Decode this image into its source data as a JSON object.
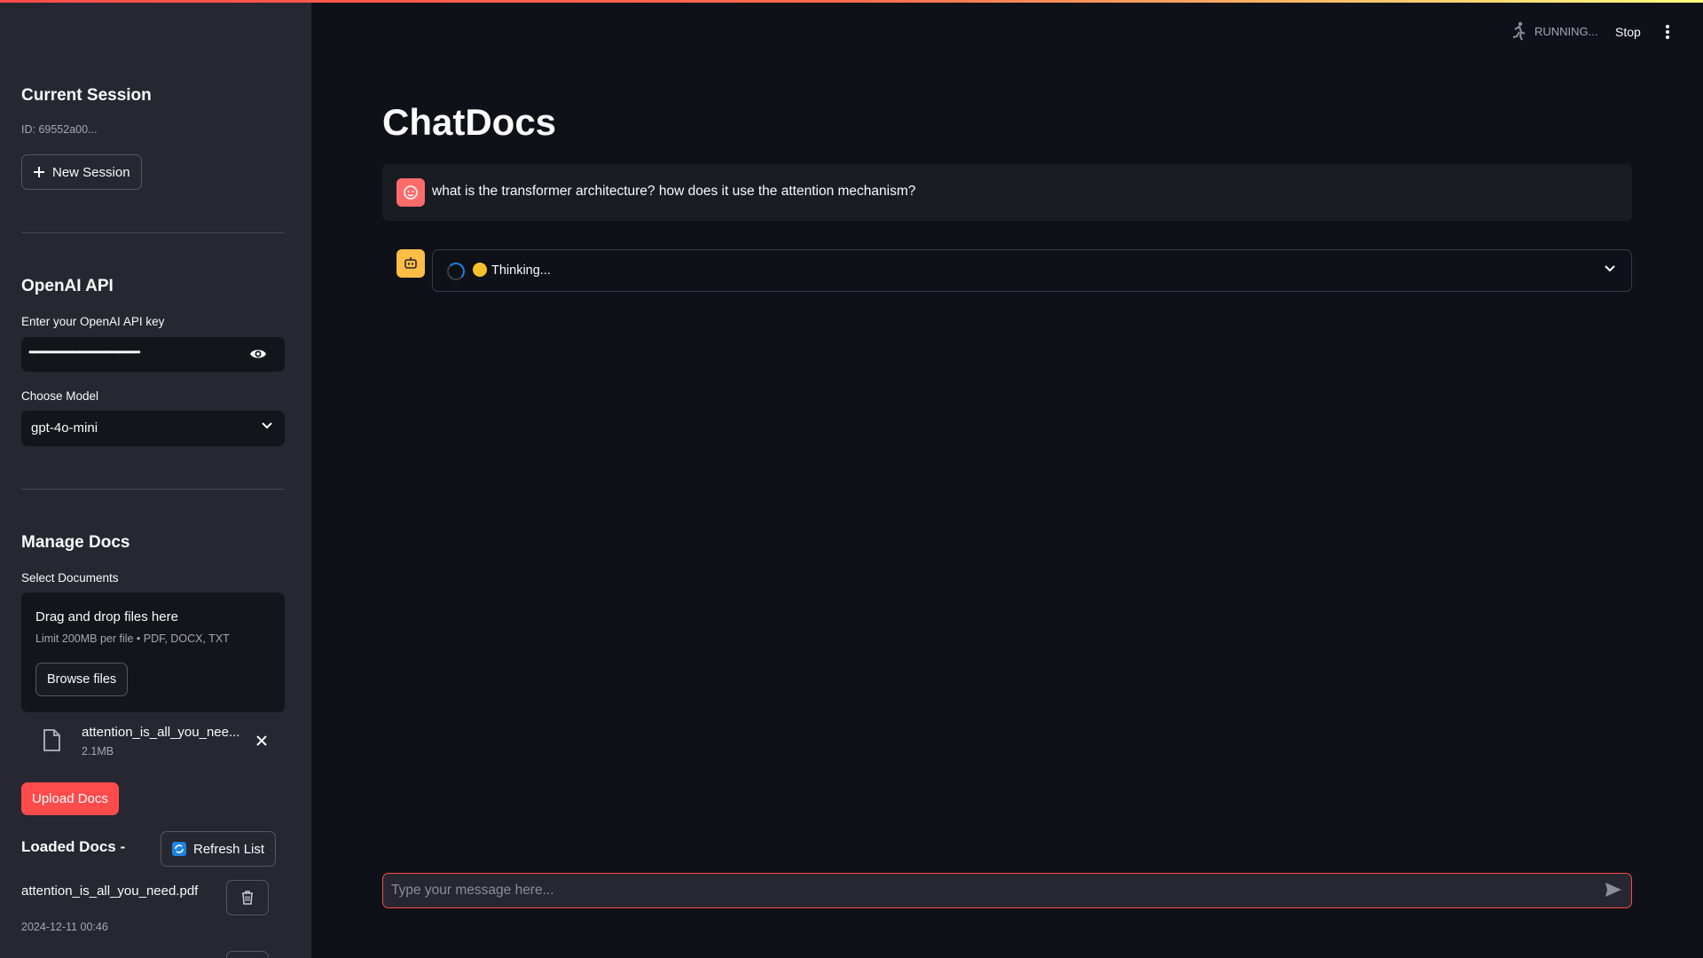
{
  "sidebar": {
    "session": {
      "heading": "Current Session",
      "id_text": "ID: 69552a00...",
      "new_button": "New Session"
    },
    "openai": {
      "heading": "OpenAI API",
      "key_label": "Enter your OpenAI API key",
      "key_value": "••••••••••••••••••••••••••••••••••••••••••••••••••••",
      "model_label": "Choose Model",
      "model_value": "gpt-4o-mini"
    },
    "docs": {
      "heading": "Manage Docs",
      "select_label": "Select Documents",
      "drop_title": "Drag and drop files here",
      "drop_sub": "Limit 200MB per file • PDF, DOCX, TXT",
      "browse_button": "Browse files",
      "file": {
        "name": "attention_is_all_you_nee...",
        "size": "2.1MB"
      },
      "upload_button": "Upload Docs",
      "loaded_heading": "Loaded Docs -",
      "refresh_button": "Refresh List",
      "loaded": [
        {
          "name": "attention_is_all_you_need.pdf",
          "date": "2024-12-11 00:46"
        }
      ]
    }
  },
  "header": {
    "status": "RUNNING...",
    "stop": "Stop"
  },
  "main": {
    "title": "ChatDocs",
    "user_message": "what is the transformer architecture? how does it use the attention mechanism?",
    "assistant_status": "Thinking...",
    "input_placeholder": "Type your message here..."
  },
  "colors": {
    "accent": "#ff4b4b",
    "sidebar_bg": "#262730",
    "main_bg": "#0e1117",
    "bot_avatar": "#ffbd45"
  },
  "icons": [
    "plus-icon",
    "eye-icon",
    "chevron-down-icon",
    "file-icon",
    "close-icon",
    "refresh-icon",
    "trash-icon",
    "running-icon",
    "kebab-icon",
    "user-avatar-icon",
    "bot-avatar-icon",
    "spinner-icon",
    "send-icon"
  ]
}
